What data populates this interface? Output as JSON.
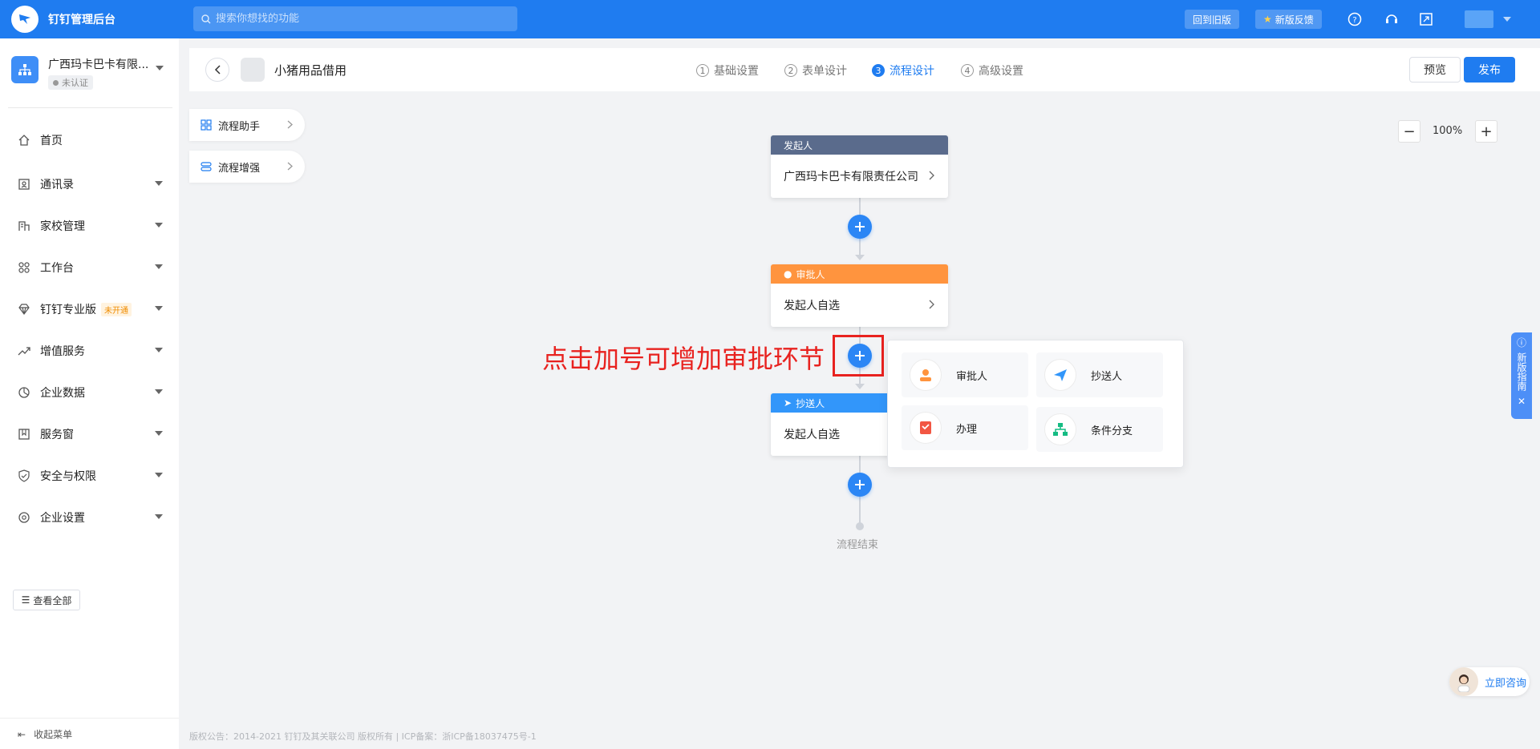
{
  "topbar": {
    "title": "钉钉管理后台",
    "search_placeholder": "搜索你想找的功能",
    "back_old_label": "回到旧版",
    "feedback_label": "新版反馈"
  },
  "sidebar": {
    "org_name": "广西玛卡巴卡有限...",
    "org_status": "未认证",
    "items": [
      {
        "label": "首页",
        "icon": "home-icon"
      },
      {
        "label": "通讯录",
        "icon": "contacts-icon"
      },
      {
        "label": "家校管理",
        "icon": "school-icon"
      },
      {
        "label": "工作台",
        "icon": "grid-icon"
      },
      {
        "label": "钉钉专业版",
        "icon": "diamond-icon",
        "badge": "未开通"
      },
      {
        "label": "增值服务",
        "icon": "trend-icon"
      },
      {
        "label": "企业数据",
        "icon": "chart-icon"
      },
      {
        "label": "服务窗",
        "icon": "window-icon"
      },
      {
        "label": "安全与权限",
        "icon": "shield-icon"
      },
      {
        "label": "企业设置",
        "icon": "settings-icon"
      }
    ],
    "view_all": "查看全部",
    "collapse": "收起菜单"
  },
  "header": {
    "form_title": "小猪用品借用",
    "steps": [
      {
        "num": "1",
        "label": "基础设置"
      },
      {
        "num": "2",
        "label": "表单设计"
      },
      {
        "num": "3",
        "label": "流程设计"
      },
      {
        "num": "4",
        "label": "高级设置"
      }
    ],
    "preview": "预览",
    "publish": "发布"
  },
  "tools": [
    {
      "label": "流程助手"
    },
    {
      "label": "流程增强"
    }
  ],
  "zoom": {
    "value": "100%"
  },
  "nodes": [
    {
      "head": "发起人",
      "body": "广西玛卡巴卡有限责任公司",
      "color": "#5a6b8c"
    },
    {
      "head": "审批人",
      "body": "发起人自选",
      "color": "#ff943e"
    },
    {
      "head": "抄送人",
      "body": "发起人自选",
      "color": "#3296fa"
    }
  ],
  "end_label": "流程结束",
  "annotation": "点击加号可增加审批环节",
  "popover": [
    {
      "label": "审批人",
      "icon": "approver-icon",
      "color": "#ff943e"
    },
    {
      "label": "抄送人",
      "icon": "send-icon",
      "color": "#3296fa"
    },
    {
      "label": "办理",
      "icon": "handle-icon",
      "color": "#f25643"
    },
    {
      "label": "条件分支",
      "icon": "branch-icon",
      "color": "#15bc83"
    }
  ],
  "guide": {
    "text": "新版指南"
  },
  "consult": {
    "label": "立即咨询"
  },
  "footer": "版权公告：2014-2021 钉钉及其关联公司 版权所有 | ICP备案：浙ICP备18037475号-1"
}
